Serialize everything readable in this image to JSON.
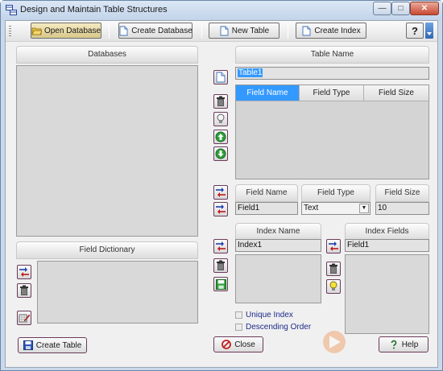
{
  "window": {
    "title": "Design and Maintain Table Structures"
  },
  "title_buttons": {
    "minimize": "—",
    "maximize": "□",
    "close": "✕"
  },
  "toolbar": {
    "open_database": "Open Database",
    "create_database": "Create Database",
    "new_table": "New Table",
    "create_index": "Create Index",
    "help_icon": "?"
  },
  "databases": {
    "header": "Databases"
  },
  "table_name": {
    "header": "Table Name",
    "value": "Table1"
  },
  "fields_grid": {
    "columns": [
      "Field Name",
      "Field Type",
      "Field Size"
    ]
  },
  "field_editor": {
    "name_label": "Field Name",
    "type_label": "Field Type",
    "size_label": "Field Size",
    "name_value": "Field1",
    "type_value": "Text",
    "size_value": "10"
  },
  "field_dictionary": {
    "header": "Field Dictionary"
  },
  "index": {
    "name_header": "Index Name",
    "fields_header": "Index Fields",
    "name_value": "Index1",
    "fields_value": "Field1",
    "unique_label": "Unique Index",
    "descending_label": "Descending Order"
  },
  "buttons": {
    "create_table": "Create Table",
    "close": "Close",
    "help": "Help"
  },
  "colors": {
    "selection": "#3399ff",
    "accent_border": "#6a3a5a"
  }
}
